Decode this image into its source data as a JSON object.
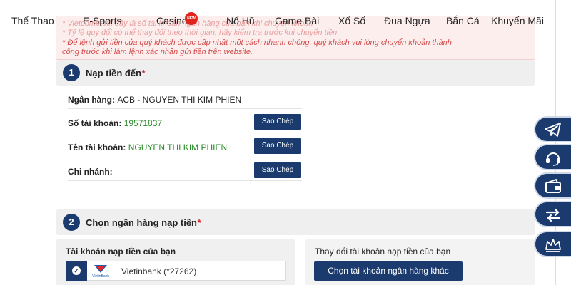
{
  "nav": {
    "items": [
      "Thể Thao",
      "E-Sports",
      "Casino",
      "Nổ Hũ",
      "Game Bài",
      "Xổ Số",
      "Đua Ngựa",
      "Bắn Cá",
      "Khuyến Mãi"
    ],
    "casino_badge": "NEW"
  },
  "notice": {
    "line1": "* Vietcombank đây là số tài khoản ngân hàng của bạn khi chuyển khoản",
    "line2": "* Tỷ lệ quy đổi có thể thay đổi theo thời gian, hãy kiểm tra trước khi chuyển tiền",
    "line3": "* Để lệnh gửi tiền của quý khách được cập nhật một cách nhanh chóng, quý khách vui lòng chuyển khoản thành",
    "line4": "công trước khi làm lệnh xác nhận gửi tiền trên website."
  },
  "section1": {
    "number": "1",
    "title": "Nạp tiền đến",
    "required_mark": "*",
    "bank_label": "Ngân hàng:",
    "bank_value": "ACB - NGUYEN THI KIM PHIEN",
    "account_no_label": "Số tài khoản:",
    "account_no_value": "19571837",
    "account_name_label": "Tên tài khoản:",
    "account_name_value": "NGUYEN THI KIM PHIEN",
    "branch_label": "Chi nhánh:",
    "branch_value": "",
    "copy_label": "Sao Chép"
  },
  "section2": {
    "number": "2",
    "title": "Chọn ngân hàng nạp tiền",
    "required_mark": "*",
    "your_account_title": "Tài khoản nạp tiền của bạn",
    "bank_logo_text": "VietinBank",
    "selected_bank": "Vietinbank (*27262)",
    "change_account_title": "Thay đổi tài khoản nạp tiền của bạn",
    "other_bank_button": "Chọn tài khoản ngân hàng khác"
  },
  "colors": {
    "primary": "#1b3b6f",
    "notice_text": "#d24a4a",
    "success_text": "#2a8a2a",
    "badge": "#e0241b"
  },
  "floating_icons": [
    "telegram-icon",
    "headset-icon",
    "wallet-icon",
    "transfer-icon",
    "crown-icon"
  ]
}
